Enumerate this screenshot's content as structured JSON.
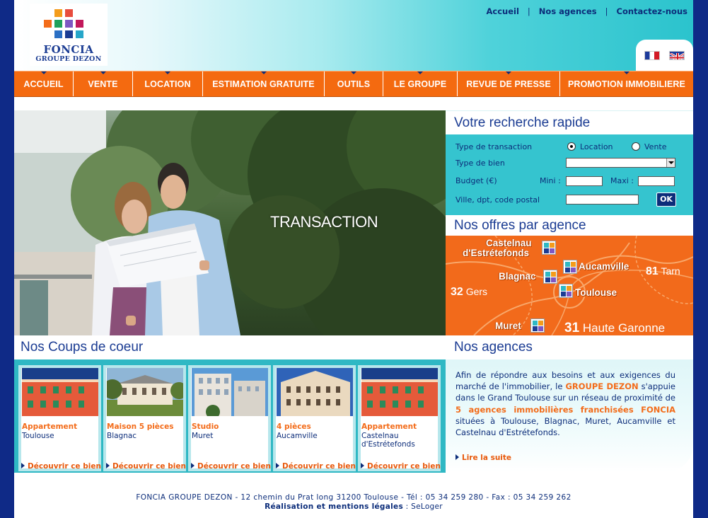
{
  "logo": {
    "brand": "FONCIA",
    "subtitle": "GROUPE DEZON"
  },
  "toplinks": [
    "Accueil",
    "Nos agences",
    "Contactez-nous"
  ],
  "languages": [
    "Français",
    "English"
  ],
  "nav": [
    "ACCUEIL",
    "VENTE",
    "LOCATION",
    "ESTIMATION  GRATUITE",
    "OUTILS",
    "LE GROUPE",
    "REVUE DE PRESSE",
    "PROMOTION IMMOBILIERE"
  ],
  "hero": {
    "label": "TRANSACTION"
  },
  "search": {
    "title": "Votre recherche rapide",
    "transaction_label": "Type de transaction",
    "option_location": "Location",
    "option_vente": "Vente",
    "selected": "Location",
    "bien_label": "Type de bien",
    "budget_label": "Budget (€)",
    "mini_label": "Mini :",
    "maxi_label": "Maxi :",
    "ville_label": "Ville, dpt, code postal",
    "ok_label": "OK"
  },
  "offers": {
    "title": "Nos offres par agence",
    "cities": {
      "castelnau_line1": "Castelnau",
      "castelnau_line2": "d'Estrétefonds",
      "aucamville": "Aucamville",
      "blagnac": "Blagnac",
      "toulouse": "Toulouse",
      "muret": "Muret"
    },
    "depts": {
      "tarn_num": "81",
      "tarn_name": "Tarn",
      "gers_num": "32",
      "gers_name": "Gers",
      "hg_num": "31",
      "hg_name": "Haute Garonne"
    }
  },
  "coeur": {
    "title": "Nos Coups de coeur",
    "cta": "Découvrir ce bien",
    "cards": [
      {
        "type": "Appartement",
        "place": "Toulouse"
      },
      {
        "type": "Maison 5 pièces",
        "place": "Blagnac"
      },
      {
        "type": "Studio",
        "place": "Muret"
      },
      {
        "type": "4 pièces",
        "place": "Aucamville"
      },
      {
        "type": "Appartement",
        "place": "Castelnau d'Estrétefonds"
      }
    ]
  },
  "agences": {
    "title": "Nos agences",
    "text_1": "Afin de répondre aux besoins et aux exigences du marché de l'immobilier, le ",
    "hl_1": "GROUPE DEZON",
    "text_2": " s'appuie dans le Grand Toulouse sur un réseau de proximité de ",
    "hl_2": "5 agences immobilières franchisées FONCIA",
    "text_3": " situées à Toulouse, Blagnac, Muret, Aucamville et Castelnau d'Estrétefonds.",
    "read_more": "Lire la suite"
  },
  "footer": {
    "address": "FONCIA GROUPE DEZON - 12 chemin du Prat long 31200 Toulouse - Tél : 05 34 259 280 - Fax : 05 34 259 262",
    "credits_label": "Réalisation et mentions légales",
    "credits_sep": " : ",
    "credits_value": "SeLoger"
  },
  "colors": {
    "accent_orange": "#f36c1a",
    "navy": "#0c2d7a",
    "teal": "#35c4cf",
    "background": "#0f2a87"
  }
}
